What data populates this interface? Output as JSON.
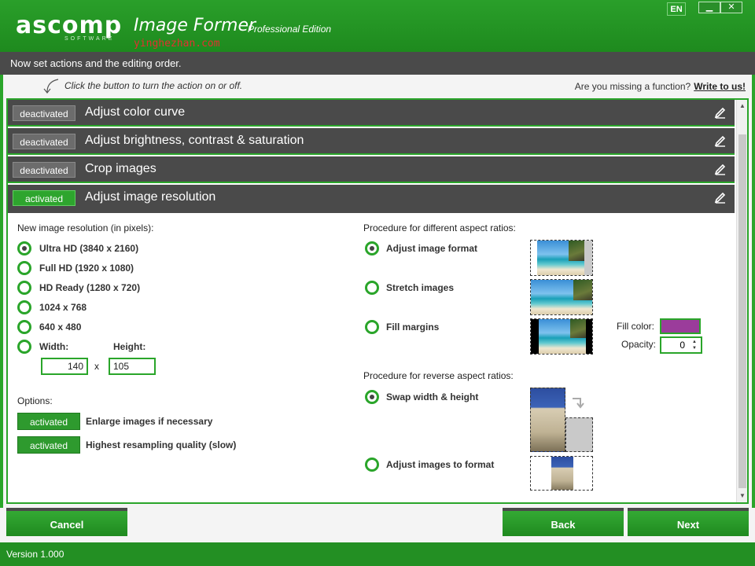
{
  "title_bar": {
    "logo_text": "ascomp",
    "logo_sub": "SOFTWARE",
    "app_name": "Image Former",
    "edition": "Professional Edition",
    "watermark": "yinghezhan.com",
    "language": "EN",
    "minimize_symbol": "▁",
    "close_symbol": "✕"
  },
  "info_bar": {
    "text": "Now set actions and the editing order."
  },
  "hint_row": {
    "hint": "Click the button to turn the action on or off.",
    "missing_text": "Are you missing a function?",
    "write_link": "Write to us!"
  },
  "actions": [
    {
      "status": "deactivated",
      "title": "Adjust color curve",
      "active": false
    },
    {
      "status": "deactivated",
      "title": "Adjust brightness, contrast & saturation",
      "active": false
    },
    {
      "status": "deactivated",
      "title": "Crop images",
      "active": false
    },
    {
      "status": "activated",
      "title": "Adjust image resolution",
      "active": true
    }
  ],
  "resolution": {
    "heading": "New image resolution (in pixels):",
    "options": [
      {
        "label": "Ultra HD (3840 x 2160)",
        "selected": true
      },
      {
        "label": "Full HD (1920 x 1080)",
        "selected": false
      },
      {
        "label": "HD Ready (1280 x 720)",
        "selected": false
      },
      {
        "label": "1024 x 768",
        "selected": false
      },
      {
        "label": "640 x 480",
        "selected": false
      },
      {
        "label": "Width:",
        "selected": false
      }
    ],
    "height_label": "Height:",
    "width_value": "140",
    "times": "x",
    "height_value": "105"
  },
  "options": {
    "heading": "Options:",
    "items": [
      {
        "status": "activated",
        "label": "Enlarge images if necessary"
      },
      {
        "status": "activated",
        "label": "Highest resampling quality (slow)"
      }
    ]
  },
  "aspect": {
    "heading": "Procedure for different aspect ratios:",
    "options": [
      {
        "label": "Adjust image format",
        "selected": true
      },
      {
        "label": "Stretch images",
        "selected": false
      },
      {
        "label": "Fill margins",
        "selected": false
      }
    ],
    "fill_color_label": "Fill color:",
    "fill_color": "#9b3c9b",
    "opacity_label": "Opacity:",
    "opacity_value": "0"
  },
  "reverse": {
    "heading": "Procedure for reverse aspect ratios:",
    "options": [
      {
        "label": "Swap width & height",
        "selected": true
      },
      {
        "label": "Adjust images to format",
        "selected": false
      }
    ]
  },
  "footer": {
    "cancel": "Cancel",
    "back": "Back",
    "next": "Next",
    "version": "Version 1.000"
  },
  "colors": {
    "accent": "#2aa52a",
    "dark": "#4a4a4a",
    "fill_swatch": "#9b3c9b"
  }
}
